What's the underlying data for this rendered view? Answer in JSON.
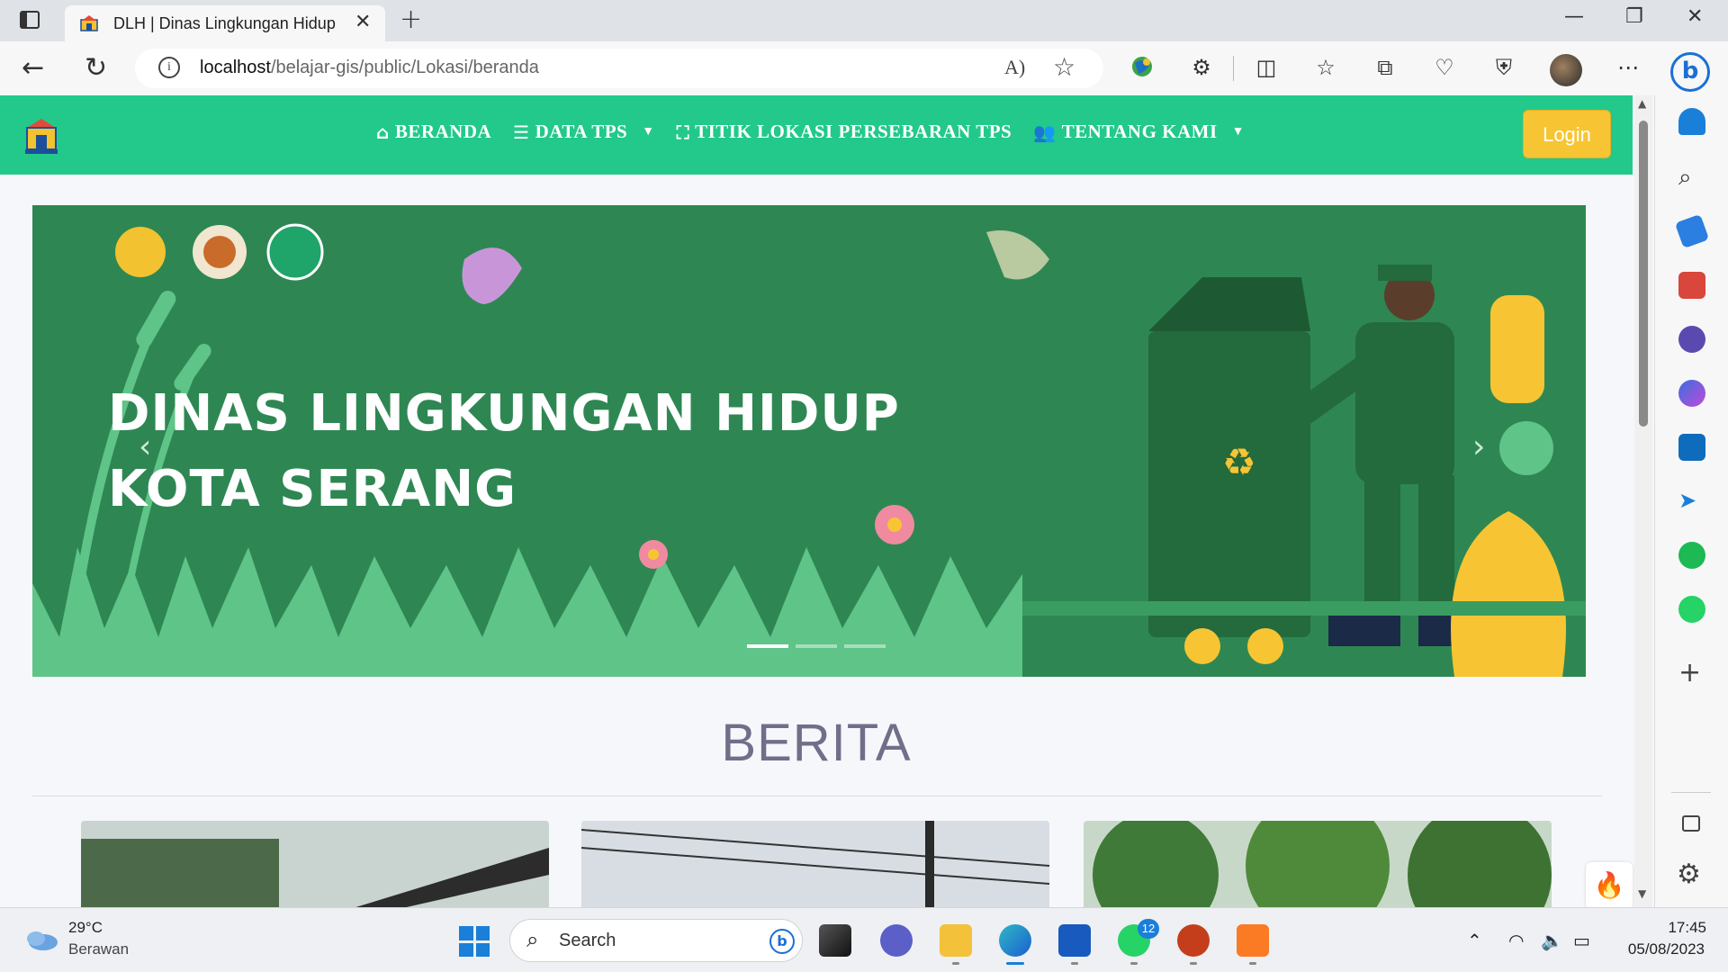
{
  "browser": {
    "tab_title": "DLH | Dinas Lingkungan Hidup",
    "tab_close": "✕",
    "new_tab": "+",
    "url_host": "localhost",
    "url_path": "/belajar-gis/public/Lokasi/beranda",
    "read_aloud": "Á",
    "bing_label": "b"
  },
  "navbar": {
    "items": [
      {
        "icon": "⌂",
        "label": "BERANDA"
      },
      {
        "icon": "☰",
        "label": "DATA TPS",
        "caret": "▼"
      },
      {
        "icon": "⛶",
        "label": "TITIK LOKASI PERSEBARAN TPS"
      },
      {
        "icon": "👥",
        "label": "TENTANG KAMI",
        "caret": "▼"
      }
    ],
    "login_label": "Login"
  },
  "carousel": {
    "title_line1": "DINAS LINGKUNGAN HIDUP",
    "title_line2": "KOTA SERANG",
    "prev": "‹",
    "next": "›",
    "slide_count": 3,
    "active_slide": 1
  },
  "section": {
    "title": "BERITA"
  },
  "taskbar": {
    "temperature": "29°C",
    "weather": "Berawan",
    "search_label": "Search",
    "whatsapp_badge": "12",
    "time": "17:45",
    "date": "05/08/2023"
  },
  "colors": {
    "nav_green": "#22c98b",
    "hero_green": "#2e8753",
    "login_yellow": "#f7c533",
    "title_grey": "#6f6f8a"
  }
}
